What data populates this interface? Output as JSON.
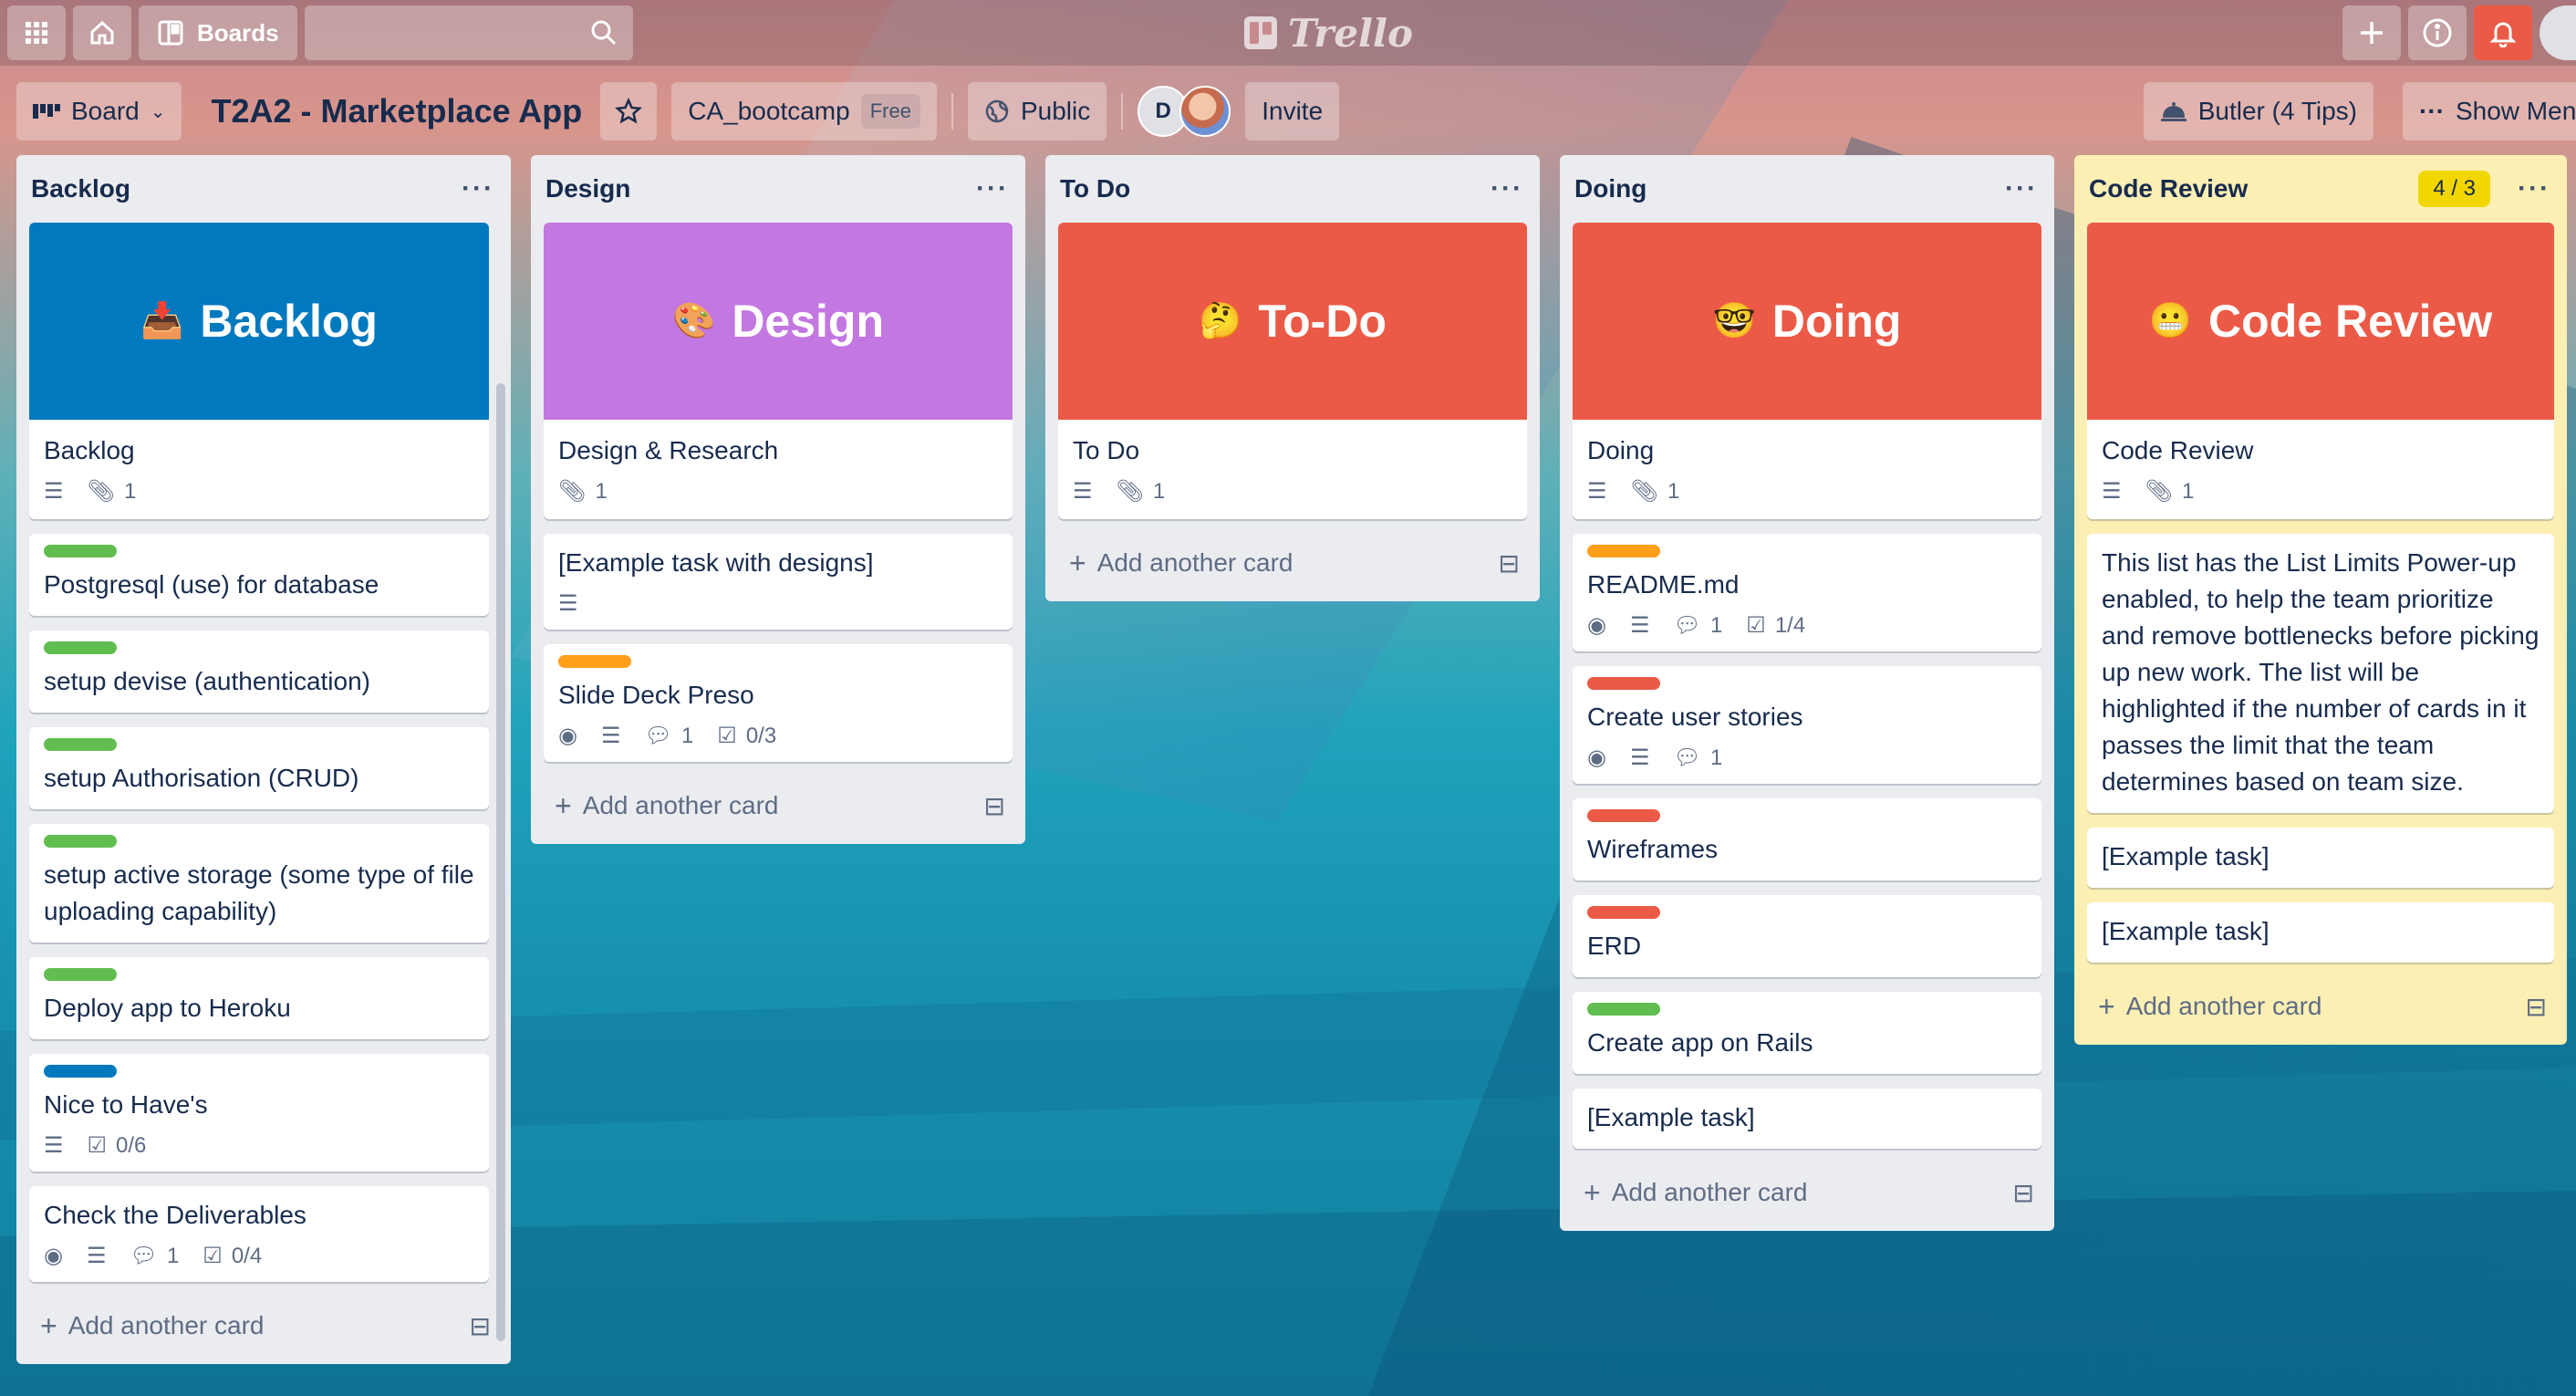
{
  "topbar": {
    "boards_label": "Boards",
    "logo_text": "Trello"
  },
  "board": {
    "view_label": "Board",
    "title": "T2A2 - Marketplace App",
    "team": "CA_bootcamp",
    "team_badge": "Free",
    "visibility": "Public",
    "member_initial": "D",
    "invite_label": "Invite",
    "butler_label": "Butler (4 Tips)",
    "show_menu_label": "Show Menu"
  },
  "colors": {
    "label_green": "#61bd4f",
    "label_orange": "#ff9f1a",
    "label_red": "#eb5a46",
    "label_blue": "#0079bf",
    "cover_backlog": "#0079bf",
    "cover_design": "#c377e0",
    "cover_todo": "#eb5a46",
    "cover_doing": "#eb5a46",
    "cover_code_review": "#eb5a46",
    "code_review_list": "#fcefb4"
  },
  "lists": [
    {
      "title": "Backlog",
      "add_label": "Add another card",
      "cover": {
        "title": "Backlog",
        "emoji": "📥",
        "body": "Backlog",
        "attachments": "1"
      },
      "cards": [
        {
          "title": "Postgresql (use) for database"
        },
        {
          "title": "setup devise (authentication)"
        },
        {
          "title": "setup Authorisation (CRUD)"
        },
        {
          "title": "setup active storage (some type of file uploading capability)"
        },
        {
          "title": "Deploy app to Heroku"
        },
        {
          "title": "Nice to Have's",
          "checklist": "0/6"
        },
        {
          "title": "Check the Deliverables",
          "comments": "1",
          "checklist": "0/4"
        }
      ]
    },
    {
      "title": "Design",
      "add_label": "Add another card",
      "cover": {
        "title": "Design",
        "emoji": "🎨",
        "body": "Design & Research",
        "attachments": "1"
      },
      "cards": [
        {
          "title": "[Example task with designs]"
        },
        {
          "title": "Slide Deck Preso",
          "comments": "1",
          "checklist": "0/3"
        }
      ]
    },
    {
      "title": "To Do",
      "add_label": "Add another card",
      "cover": {
        "title": "To-Do",
        "emoji": "🤔",
        "body": "To Do",
        "attachments": "1"
      },
      "cards": []
    },
    {
      "title": "Doing",
      "add_label": "Add another card",
      "cover": {
        "title": "Doing",
        "emoji": "🤓",
        "body": "Doing",
        "attachments": "1"
      },
      "cards": [
        {
          "title": "README.md",
          "comments": "1",
          "checklist": "1/4"
        },
        {
          "title": "Create user stories",
          "comments": "1"
        },
        {
          "title": "Wireframes"
        },
        {
          "title": "ERD"
        },
        {
          "title": "Create app on Rails"
        },
        {
          "title": "[Example task]"
        }
      ]
    },
    {
      "title": "Code Review",
      "limit": "4 / 3",
      "add_label": "Add another card",
      "cover": {
        "title": "Code Review",
        "emoji": "😬",
        "body": "Code Review",
        "attachments": "1"
      },
      "cards": [
        {
          "title": "This list has the List Limits Power-up enabled, to help the team prioritize and remove bottlenecks before picking up new work. The list will be highlighted if the number of cards in it passes the limit that the team determines based on team size."
        },
        {
          "title": "[Example task]"
        },
        {
          "title": "[Example task]"
        }
      ]
    }
  ]
}
